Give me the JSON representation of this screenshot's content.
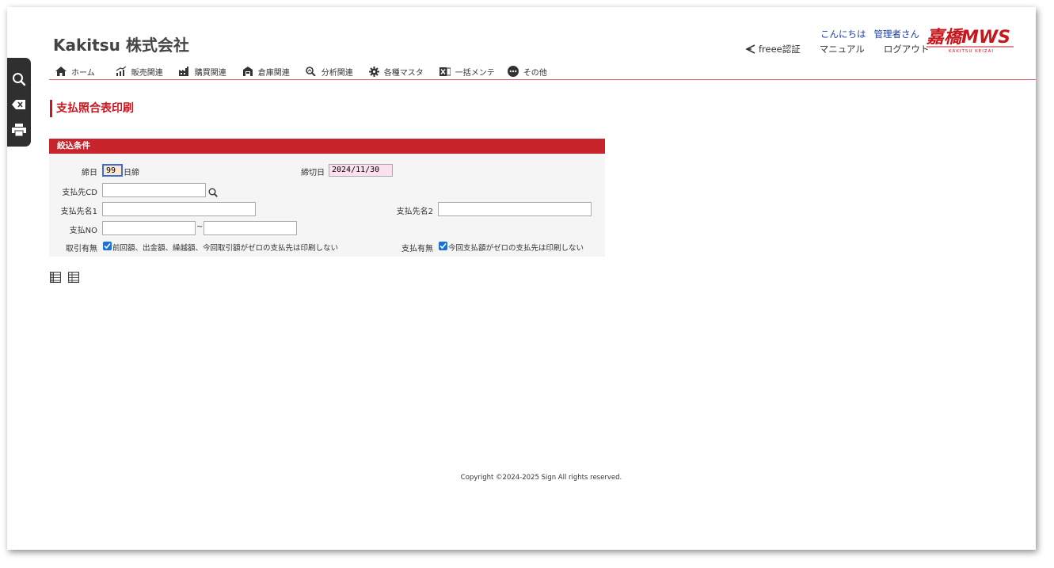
{
  "brand": {
    "title": "Kakitsu 株式会社"
  },
  "header": {
    "greeting": "こんにちは",
    "user_name": "管理者さん",
    "freee_label": "freee認証",
    "manual_label": "マニュアル",
    "logout_label": "ログアウト",
    "logo_text": "嘉橋MWS",
    "logo_sub": "KAKITSU KEIZAI"
  },
  "nav": {
    "items": [
      {
        "label": "ホーム"
      },
      {
        "label": "販売関連"
      },
      {
        "label": "購買関連"
      },
      {
        "label": "倉庫関連"
      },
      {
        "label": "分析関連"
      },
      {
        "label": "各種マスタ"
      },
      {
        "label": "一括メンテ"
      },
      {
        "label": "その他"
      }
    ]
  },
  "page": {
    "title": "支払照合表印刷"
  },
  "filter": {
    "header": "絞込条件",
    "shime_label": "締日",
    "shime_value": "99",
    "shime_suffix": "日締",
    "shimekiri_label": "締切日",
    "shimekiri_value": "2024/11/30",
    "payee_cd_label": "支払先CD",
    "payee_cd_value": "",
    "payee_name1_label": "支払先名1",
    "payee_name1_value": "",
    "payee_name2_label": "支払先名2",
    "payee_name2_value": "",
    "payment_no_label": "支払NO",
    "payment_no_from": "",
    "payment_no_to": "",
    "range_sep": "~",
    "trade_label": "取引有無",
    "trade_text": "前回額、出金額、繰越額、今回取引額がゼロの支払先は印刷しない",
    "pay_label": "支払有無",
    "pay_text": "今回支払額がゼロの支払先は印刷しない"
  },
  "footer": {
    "copyright": "Copyright ©2024-2025 Sign All rights reserved."
  },
  "colors": {
    "accent": "#c8161d",
    "link": "#1a3ea8",
    "checkbox": "#1a6fd8"
  }
}
